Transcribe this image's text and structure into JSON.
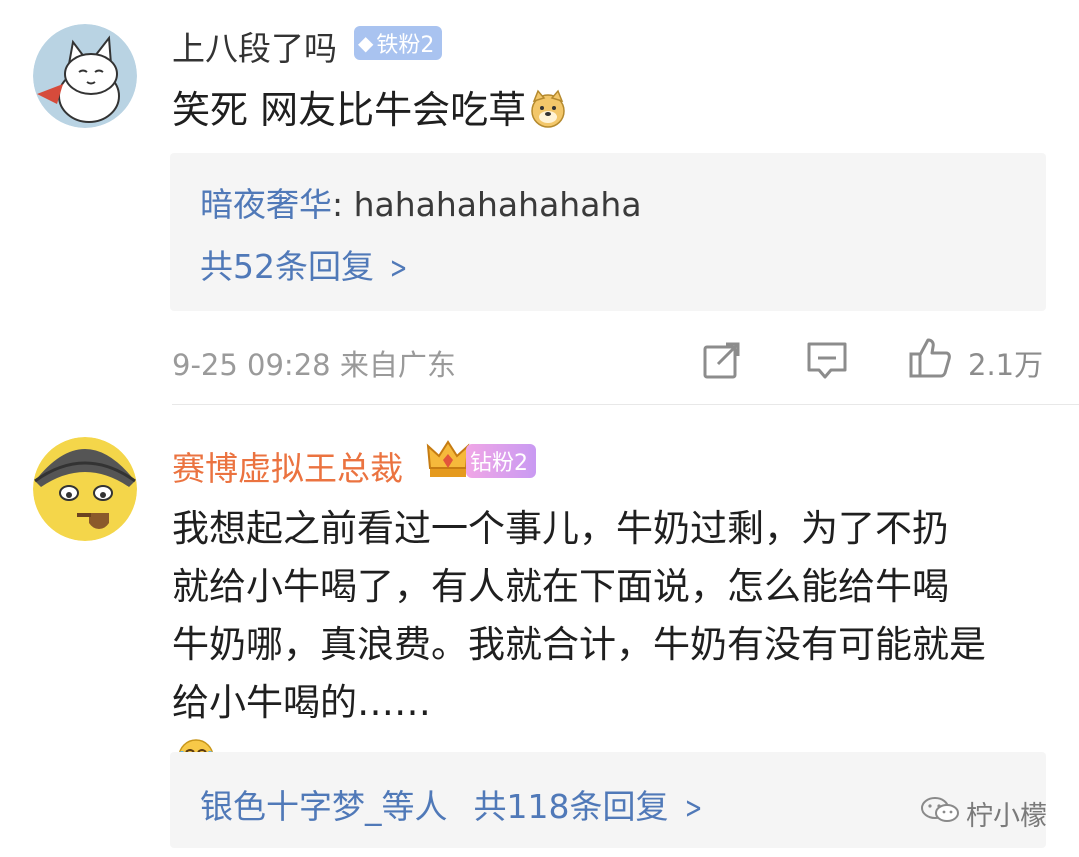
{
  "comments": [
    {
      "username": "上八段了吗",
      "badge": "铁粉2",
      "text": "笑死 网友比牛会吃草",
      "emoji": "doge-emoji",
      "reply_preview": {
        "author": "暗夜奢华",
        "text": ": hahahahahahaha"
      },
      "reply_count_label": "共52条回复",
      "meta": "9-25 09:28 来自广东",
      "like_count": "2.1万"
    },
    {
      "username": "赛博虚拟王总裁",
      "badge": "钻粉2",
      "text_lines": [
        "我想起之前看过一个事儿，牛奶过剩，为了不扔",
        "就给小牛喝了，有人就在下面说，怎么能给牛喝",
        "牛奶哪，真浪费。我就合计，牛奶有没有可能就是",
        "给小牛喝的……"
      ],
      "emoji": "laugh-cry-emoji",
      "reply_users": "银色十字梦_等人",
      "reply_count_label": "共118条回复"
    }
  ],
  "watermark": "柠小檬",
  "colors": {
    "username_highlight": "#eb7340",
    "link_blue": "#5079b8",
    "reply_bg": "#f5f5f5"
  }
}
